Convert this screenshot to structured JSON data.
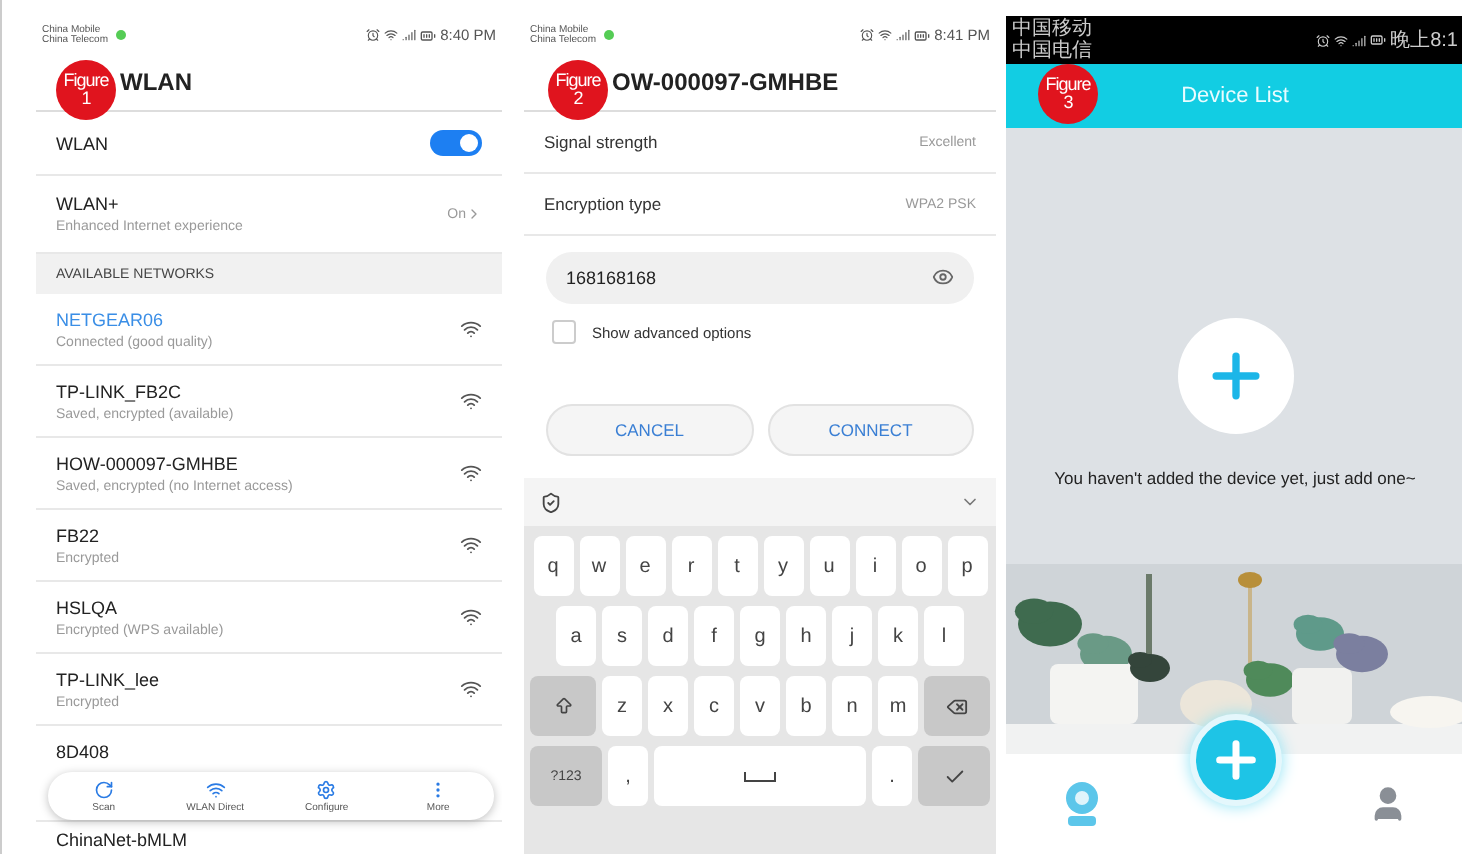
{
  "wlan_screen": {
    "status_bar": {
      "carriers": [
        "China Mobile",
        "China Telecom"
      ],
      "time": "8:40 PM"
    },
    "badge": {
      "label": "Figure",
      "number": "1"
    },
    "title": "WLAN",
    "wlan": {
      "label": "WLAN",
      "on": true
    },
    "wlan_plus": {
      "label": "WLAN+",
      "subtitle": "Enhanced Internet experience",
      "value": "On"
    },
    "section_header": "AVAILABLE NETWORKS",
    "networks": [
      {
        "name": "NETGEAR06",
        "status": "Connected (good quality)",
        "connected": true
      },
      {
        "name": "TP-LINK_FB2C",
        "status": "Saved, encrypted (available)",
        "connected": false
      },
      {
        "name": "HOW-000097-GMHBE",
        "status": "Saved, encrypted (no Internet access)",
        "connected": false
      },
      {
        "name": "FB22",
        "status": "Encrypted",
        "connected": false
      },
      {
        "name": "HSLQA",
        "status": "Encrypted (WPS available)",
        "connected": false
      },
      {
        "name": "TP-LINK_lee",
        "status": "Encrypted",
        "connected": false
      },
      {
        "name": "8D408",
        "connected": false
      },
      {
        "name": "ChinaNet-bMLM",
        "connected": false
      }
    ],
    "bottom_bar": [
      {
        "label": "Scan"
      },
      {
        "label": "WLAN Direct"
      },
      {
        "label": "Configure"
      },
      {
        "label": "More"
      }
    ]
  },
  "connect_screen": {
    "status_bar": {
      "carriers": [
        "China Mobile",
        "China Telecom"
      ],
      "time": "8:41 PM"
    },
    "badge": {
      "label": "Figure",
      "number": "2"
    },
    "title": "OW-000097-GMHBE",
    "details": [
      {
        "label": "Signal strength",
        "value": "Excellent"
      },
      {
        "label": "Encryption type",
        "value": "WPA2 PSK"
      }
    ],
    "password": {
      "value": "168168168"
    },
    "advanced": {
      "label": "Show advanced options",
      "checked": false
    },
    "buttons": [
      {
        "label": "CANCEL"
      },
      {
        "label": "CONNECT"
      }
    ],
    "keyboard": {
      "rows": [
        [
          {
            "kind": "letter",
            "label": "q"
          },
          {
            "kind": "letter",
            "label": "w"
          },
          {
            "kind": "letter",
            "label": "e"
          },
          {
            "kind": "letter",
            "label": "r"
          },
          {
            "kind": "letter",
            "label": "t"
          },
          {
            "kind": "letter",
            "label": "y"
          },
          {
            "kind": "letter",
            "label": "u"
          },
          {
            "kind": "letter",
            "label": "i"
          },
          {
            "kind": "letter",
            "label": "o"
          },
          {
            "kind": "letter",
            "label": "p"
          }
        ],
        [
          {
            "kind": "letter",
            "label": "a"
          },
          {
            "kind": "letter",
            "label": "s"
          },
          {
            "kind": "letter",
            "label": "d"
          },
          {
            "kind": "letter",
            "label": "f"
          },
          {
            "kind": "letter",
            "label": "g"
          },
          {
            "kind": "letter",
            "label": "h"
          },
          {
            "kind": "letter",
            "label": "j"
          },
          {
            "kind": "letter",
            "label": "k"
          },
          {
            "kind": "letter",
            "label": "l"
          }
        ],
        [
          {
            "kind": "shift"
          },
          {
            "kind": "letter",
            "label": "z"
          },
          {
            "kind": "letter",
            "label": "x"
          },
          {
            "kind": "letter",
            "label": "c"
          },
          {
            "kind": "letter",
            "label": "v"
          },
          {
            "kind": "letter",
            "label": "b"
          },
          {
            "kind": "letter",
            "label": "n"
          },
          {
            "kind": "letter",
            "label": "m"
          },
          {
            "kind": "backspace"
          }
        ],
        [
          {
            "kind": "symbols",
            "label": "?123"
          },
          {
            "kind": "letter",
            "label": ","
          },
          {
            "kind": "space"
          },
          {
            "kind": "letter",
            "label": "."
          },
          {
            "kind": "enter"
          }
        ]
      ]
    }
  },
  "device_screen": {
    "status_bar": {
      "carriers": [
        "中国移动",
        "中国电信"
      ],
      "time": "晚上8:1"
    },
    "badge": {
      "label": "Figure",
      "number": "3"
    },
    "title": "Device List",
    "empty_message": "You haven't added the device yet, just add one~"
  }
}
